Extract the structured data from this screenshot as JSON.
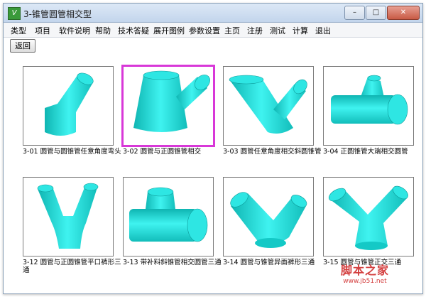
{
  "window": {
    "title": "3-锥管圆管相交型"
  },
  "menu": [
    "类型",
    "项目",
    "软件说明",
    "帮助",
    "技术答疑",
    "展开图例",
    "参数设置",
    "主页",
    "注册",
    "测试",
    "计算",
    "退出"
  ],
  "toolbar": {
    "back_label": "返回"
  },
  "items": [
    {
      "caption": "3-01 圆管与圆锥管任意角度弯头"
    },
    {
      "caption": "3-02 圆管与正圆锥管相交"
    },
    {
      "caption": "3-03 圆管任意角度相交斜圆锥管"
    },
    {
      "caption": "3-04 正圆锥管大端相交圆管"
    },
    {
      "caption": "3-12 圆管与正圆锥管平口裤形三通"
    },
    {
      "caption": "3-13 带补料斜锥管相交圆管三通"
    },
    {
      "caption": "3-14 圆管与锥管异面裤形三通"
    },
    {
      "caption": "3-15 圆管与锥管正交三通"
    }
  ],
  "selected_index": 1,
  "colors": {
    "shape": "#22e0dd",
    "selection": "#d838d8"
  },
  "watermark": {
    "line1": "脚本之家",
    "line2": "www.jb51.net"
  }
}
